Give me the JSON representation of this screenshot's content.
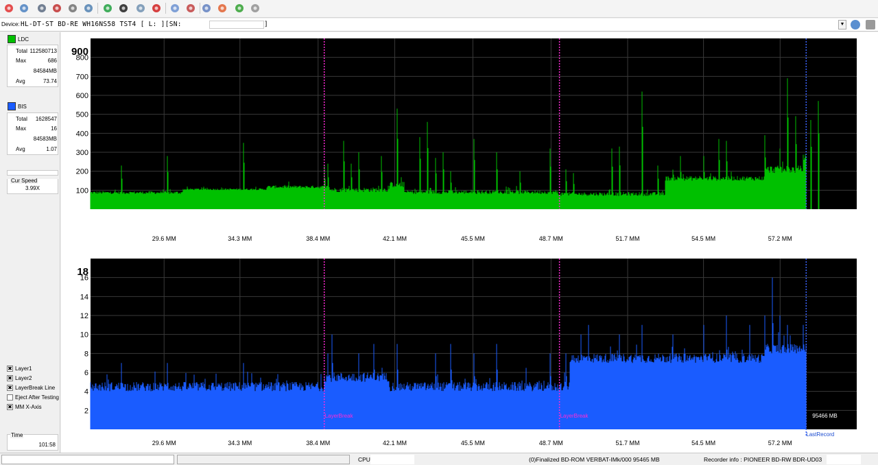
{
  "toolbar": {
    "icons": [
      "power-icon",
      "disc-info-icon",
      "drive-icon",
      "erase-icon",
      "disc-icon",
      "burn-icon",
      "refresh-icon",
      "globe-icon",
      "check-icon",
      "stop-icon",
      "bubble-icon",
      "eject-icon",
      "settings-icon",
      "palette-icon",
      "chart-icon",
      "clean-icon"
    ],
    "colors": [
      "#e03030",
      "#4a80c0",
      "#5a6a80",
      "#c03030",
      "#707070",
      "#5080b0",
      "#20a040",
      "#202020",
      "#7090b0",
      "#d02020",
      "#6a90d0",
      "#c04040",
      "#6080c0",
      "#e06030",
      "#30a030",
      "#909090"
    ]
  },
  "device": {
    "label": "Device:",
    "value": "HL-DT-ST BD-RE  WH16NS58  TST4 [ L: ][SN:",
    "sn_close": "]"
  },
  "ldc": {
    "label": "LDC",
    "color": "#00c000",
    "total_label": "Total",
    "total": "112580713",
    "max_label": "Max",
    "max": "686",
    "size": "84584MB",
    "avg_label": "Avg",
    "avg": "73.74"
  },
  "bis": {
    "label": "BIS",
    "color": "#1a5cff",
    "total_label": "Total",
    "total": "1628547",
    "max_label": "Max",
    "max": "16",
    "size": "84583MB",
    "avg_label": "Avg",
    "avg": "1.07"
  },
  "speed": {
    "label": "Cur Speed",
    "value": "3.99X"
  },
  "options": [
    {
      "label": "Layer1",
      "checked": true
    },
    {
      "label": "Layer2",
      "checked": true
    },
    {
      "label": "LayerBreak Line",
      "checked": true
    },
    {
      "label": "Eject After Testing",
      "checked": false
    },
    {
      "label": "MM X-Axis",
      "checked": true
    }
  ],
  "time": {
    "label": "Time",
    "value": "101:58"
  },
  "status": {
    "cpu_label": "CPU:",
    "disc": "(0)Finalized  BD-ROM  VERBAT-IMk/000  95465 MB",
    "recorder": "Recorder info : PIONEER     BD-RW  BDR-UD03"
  },
  "chart_data": [
    {
      "type": "area",
      "title": "LDC",
      "color": "#00c000",
      "x_tick_labels": [
        "29.6 MM",
        "34.3 MM",
        "38.4 MM",
        "42.1 MM",
        "45.5 MM",
        "48.7 MM",
        "51.7 MM",
        "54.5 MM",
        "57.2 MM"
      ],
      "y_ticks": [
        100,
        200,
        300,
        400,
        500,
        600,
        700,
        800
      ],
      "y_top_label": "900",
      "ylim": [
        0,
        900
      ],
      "layer_breaks_label": "",
      "baseline_segments": [
        [
          0,
          80,
          95
        ],
        [
          0.12,
          100,
          110
        ],
        [
          0.23,
          110,
          125
        ],
        [
          0.31,
          90,
          115
        ],
        [
          0.39,
          115,
          145
        ],
        [
          0.41,
          80,
          100
        ],
        [
          0.61,
          70,
          90
        ],
        [
          0.75,
          150,
          175
        ],
        [
          0.88,
          190,
          230
        ],
        [
          0.93,
          260,
          290
        ],
        [
          0.954,
          260,
          290
        ]
      ],
      "spikes": [
        [
          0.04,
          230
        ],
        [
          0.1,
          280
        ],
        [
          0.2,
          350
        ],
        [
          0.305,
          230
        ],
        [
          0.31,
          240
        ],
        [
          0.33,
          360
        ],
        [
          0.34,
          240
        ],
        [
          0.35,
          300
        ],
        [
          0.38,
          280
        ],
        [
          0.4,
          530
        ],
        [
          0.43,
          380
        ],
        [
          0.44,
          460
        ],
        [
          0.45,
          270
        ],
        [
          0.46,
          300
        ],
        [
          0.47,
          200
        ],
        [
          0.5,
          370
        ],
        [
          0.53,
          300
        ],
        [
          0.56,
          200
        ],
        [
          0.6,
          320
        ],
        [
          0.62,
          210
        ],
        [
          0.63,
          190
        ],
        [
          0.68,
          320
        ],
        [
          0.69,
          330
        ],
        [
          0.72,
          620
        ],
        [
          0.74,
          230
        ],
        [
          0.77,
          280
        ],
        [
          0.8,
          280
        ],
        [
          0.82,
          370
        ],
        [
          0.83,
          360
        ],
        [
          0.88,
          390
        ],
        [
          0.9,
          320
        ],
        [
          0.91,
          690
        ],
        [
          0.92,
          490
        ],
        [
          0.94,
          470
        ],
        [
          0.95,
          570
        ]
      ],
      "layer_break_x": [
        0.305,
        0.612
      ],
      "end_x": 0.934
    },
    {
      "type": "area",
      "title": "BIS",
      "color": "#1a5cff",
      "x_tick_labels": [
        "29.6 MM",
        "34.3 MM",
        "38.4 MM",
        "42.1 MM",
        "45.5 MM",
        "48.7 MM",
        "51.7 MM",
        "54.5 MM",
        "57.2 MM"
      ],
      "y_ticks": [
        2,
        4,
        6,
        8,
        10,
        12,
        14,
        16
      ],
      "y_top_label": "18",
      "ylim": [
        0,
        18
      ],
      "baseline_segments": [
        [
          0,
          4,
          5
        ],
        [
          0.305,
          5,
          6
        ],
        [
          0.39,
          4,
          5
        ],
        [
          0.61,
          4,
          5
        ],
        [
          0.625,
          7,
          8
        ],
        [
          0.855,
          7,
          8
        ],
        [
          0.88,
          8,
          9
        ],
        [
          0.93,
          8,
          9
        ]
      ],
      "spikes": [
        [
          0.04,
          7
        ],
        [
          0.1,
          7
        ],
        [
          0.2,
          7
        ],
        [
          0.31,
          8
        ],
        [
          0.315,
          10
        ],
        [
          0.35,
          8
        ],
        [
          0.37,
          9
        ],
        [
          0.4,
          9
        ],
        [
          0.45,
          8
        ],
        [
          0.47,
          9
        ],
        [
          0.5,
          8
        ],
        [
          0.53,
          9
        ],
        [
          0.53,
          8
        ],
        [
          0.6,
          8
        ],
        [
          0.62,
          8
        ],
        [
          0.64,
          10
        ],
        [
          0.65,
          11
        ],
        [
          0.69,
          10
        ],
        [
          0.72,
          11
        ],
        [
          0.76,
          10
        ],
        [
          0.8,
          11
        ],
        [
          0.83,
          12
        ],
        [
          0.86,
          11
        ],
        [
          0.88,
          12
        ],
        [
          0.89,
          16
        ],
        [
          0.9,
          12
        ],
        [
          0.91,
          11
        ],
        [
          0.93,
          11
        ]
      ],
      "layer_break_x": [
        0.305,
        0.612
      ],
      "layer_break_label": "LayerBreak",
      "end_x": 0.934,
      "end_label": "95466 MB",
      "last_record_label": "LastRecord"
    }
  ]
}
